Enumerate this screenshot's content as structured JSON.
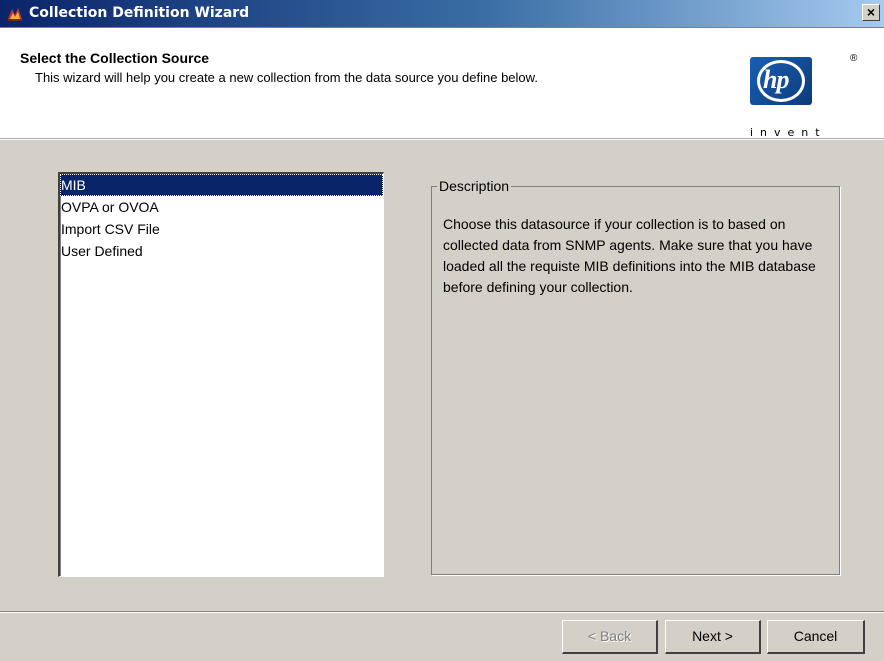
{
  "window": {
    "title": "Collection Definition Wizard",
    "close_label": "×"
  },
  "header": {
    "title": "Select the Collection Source",
    "subtitle": "This wizard will help you create a new collection from the data source you define below.",
    "logo": {
      "mark": "hp",
      "registered": "®",
      "tagline": "invent"
    }
  },
  "sources": {
    "selected": "MIB",
    "items": [
      {
        "label": "MIB"
      },
      {
        "label": "OVPA or OVOA"
      },
      {
        "label": "Import CSV File"
      },
      {
        "label": "User Defined"
      }
    ]
  },
  "description": {
    "legend": "Description",
    "text": "Choose this datasource if your collection is to based on collected data from SNMP agents. Make sure that you have loaded all the requiste MIB definitions into the MIB database before defining your collection."
  },
  "buttons": {
    "back": "< Back",
    "next": "Next >",
    "cancel": "Cancel"
  },
  "colors": {
    "title_bar_start": "#0a246a",
    "title_bar_end": "#a6caf0",
    "selection": "#0a246a",
    "dialog_bg": "#d4d0c8",
    "hp_blue": "#1a5fb4"
  }
}
